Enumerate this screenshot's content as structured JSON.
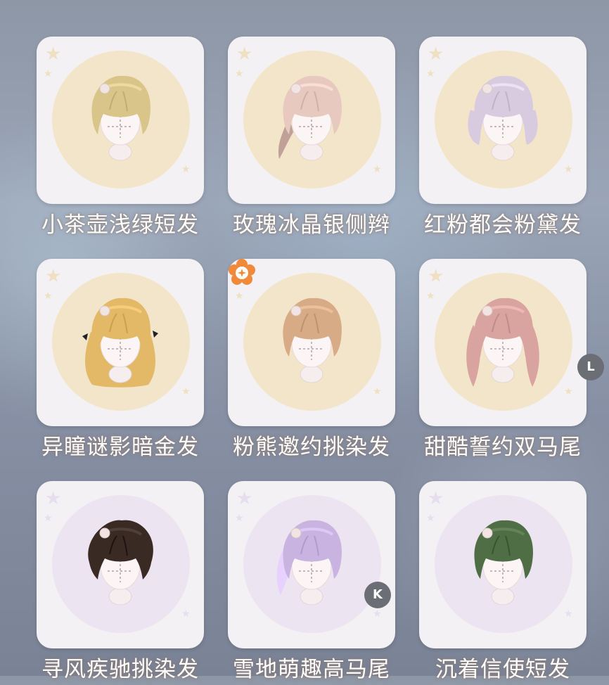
{
  "colors": {
    "card_bg": "#f3f1f3",
    "circle_gold": "#f3e5c9",
    "circle_purple": "#ece4f0",
    "key_badge_bg": "#6b6e74",
    "new_badge": "#f08a3a"
  },
  "items": [
    {
      "name": "小茶壶浅绿短发",
      "icon": "hair-short-olive-icon",
      "hair_color": "#d9c58a",
      "style": "short",
      "circle": "gold"
    },
    {
      "name": "玫瑰冰晶银侧辫",
      "icon": "hair-side-braid-rose-icon",
      "hair_color": "#e8c9c0",
      "style": "side-tail",
      "circle": "gold"
    },
    {
      "name": "红粉都会粉黛发",
      "icon": "hair-wavy-lilac-icon",
      "hair_color": "#d8cbe0",
      "style": "wavy",
      "circle": "gold"
    },
    {
      "name": "异瞳谜影暗金发",
      "icon": "hair-long-curly-gold-icon",
      "hair_color": "#e3b866",
      "style": "long-curly",
      "circle": "gold"
    },
    {
      "name": "粉熊邀约挑染发",
      "icon": "hair-medium-caramel-icon",
      "hair_color": "#d6ab85",
      "style": "medium",
      "circle": "gold",
      "new": true
    },
    {
      "name": "甜酷誓约双马尾",
      "icon": "hair-twin-tails-pink-icon",
      "hair_color": "#d9a3a0",
      "style": "twin",
      "circle": "gold"
    },
    {
      "name": "寻风疾驰挑染发",
      "icon": "hair-messy-dark-brown-icon",
      "hair_color": "#3a2a24",
      "style": "messy",
      "circle": "purple"
    },
    {
      "name": "雪地萌趣高马尾",
      "icon": "hair-high-ponytail-lavender-icon",
      "hair_color": "#c9b3e0",
      "style": "ponytail",
      "circle": "purple"
    },
    {
      "name": "沉着信使短发",
      "icon": "hair-bob-green-icon",
      "hair_color": "#4f6e45",
      "style": "bob",
      "circle": "purple"
    }
  ],
  "hotkeys": {
    "right": "L",
    "item": "K"
  }
}
